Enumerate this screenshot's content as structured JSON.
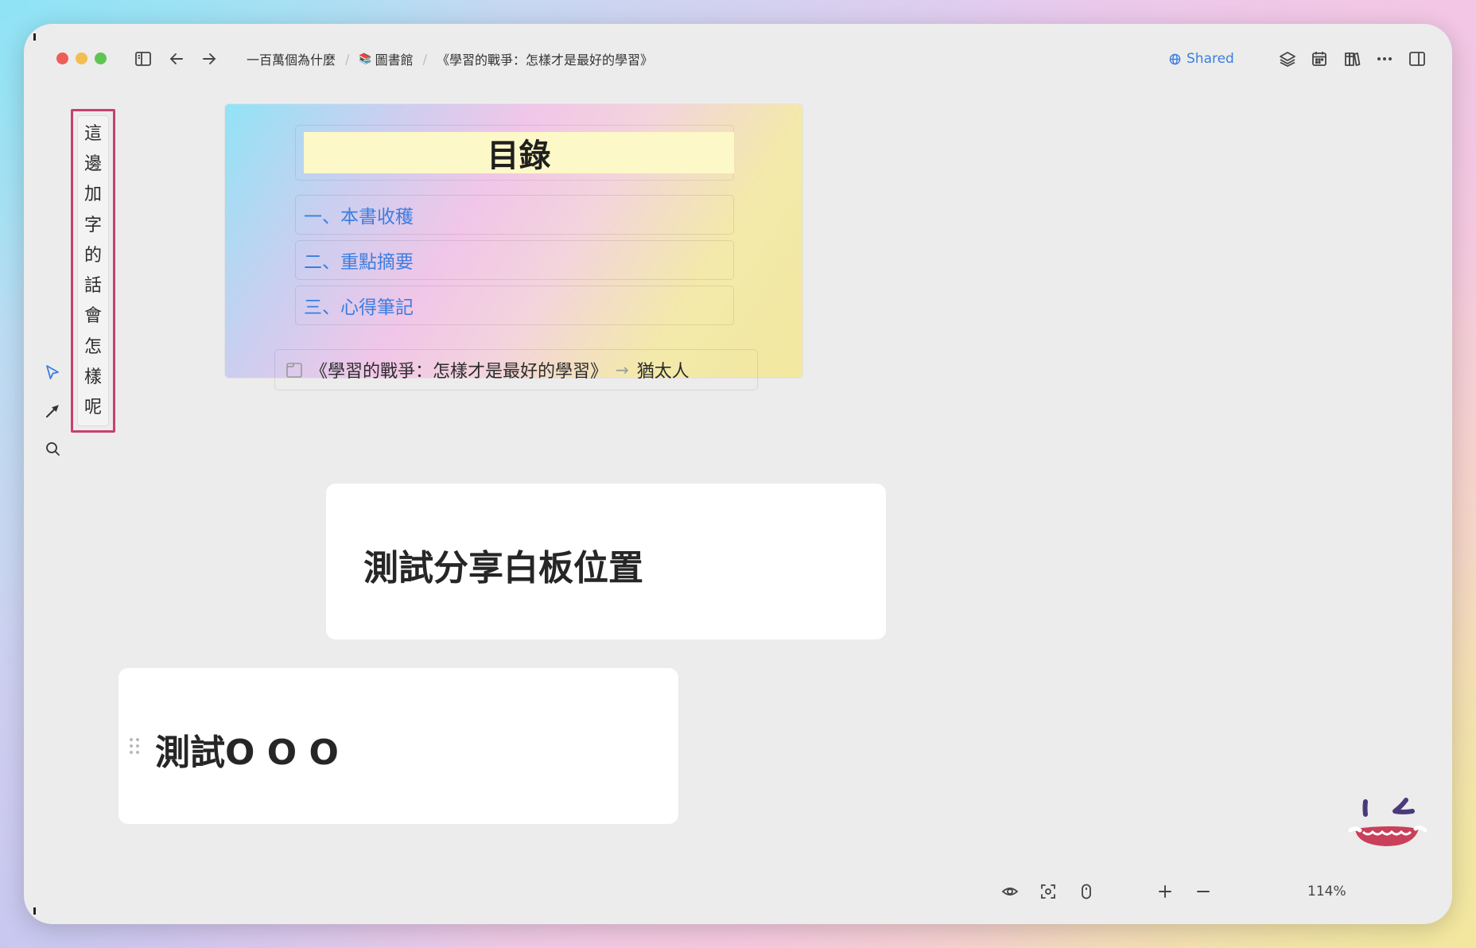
{
  "window": {
    "breadcrumbs": [
      "一百萬個為什麼",
      "圖書館",
      "《學習的戰爭：怎樣才是最好的學習》"
    ],
    "breadcrumb_emoji": "📚",
    "shared_label": "Shared",
    "accent_color": "#3b7ee0"
  },
  "toolbar_icons": [
    "sidebar-toggle-icon",
    "back-arrow-icon",
    "forward-arrow-icon",
    "layers-icon",
    "calendar-icon",
    "library-icon",
    "more-icon",
    "right-panel-icon"
  ],
  "tools": [
    "pointer-icon",
    "arrow-tool-icon",
    "search-icon"
  ],
  "vertical_text": [
    "這",
    "邊",
    "加",
    "字",
    "的",
    "話",
    "會",
    "怎",
    "樣",
    "呢"
  ],
  "annotation_color": "#c8416b",
  "toc": {
    "title": "目錄",
    "items": [
      "一、本書收穫",
      "二、重點摘要",
      "三、心得筆記"
    ],
    "link_text": "《學習的戰爭：怎樣才是最好的學習》",
    "link_arrow": "→",
    "link_target": "猶太人"
  },
  "notes": [
    {
      "title": "測試分享白板位置"
    },
    {
      "title": "測試O O O"
    }
  ],
  "bottom_bar": {
    "zoom": "114%",
    "icons": [
      "eye-icon",
      "focus-icon",
      "mouse-icon",
      "zoom-in-icon",
      "zoom-out-icon"
    ]
  }
}
